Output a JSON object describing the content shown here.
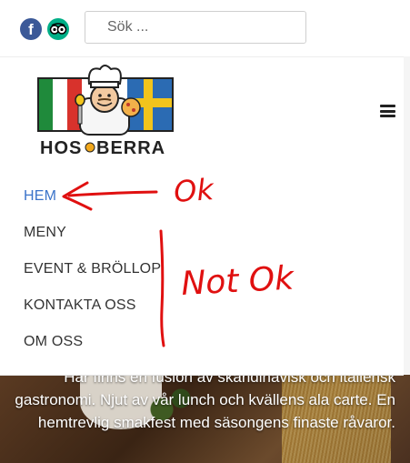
{
  "topbar": {
    "facebook_icon": "facebook-icon",
    "tripadvisor_icon": "tripadvisor-icon",
    "search_placeholder": "Sök ..."
  },
  "logo": {
    "text_left": "HOS",
    "text_right": "BERRA",
    "colors": {
      "italy_green": "#1f8a3b",
      "italy_red": "#d8322c",
      "sweden_blue": "#2b6bb3",
      "sweden_yellow": "#f2c41c"
    }
  },
  "nav": {
    "toggle_icon": "hamburger-menu-icon",
    "items": [
      {
        "label": "HEM",
        "active": true
      },
      {
        "label": "MENY",
        "active": false
      },
      {
        "label": "EVENT & BRÖLLOP",
        "active": false
      },
      {
        "label": "KONTAKTA OSS",
        "active": false
      },
      {
        "label": "OM OSS",
        "active": false
      }
    ]
  },
  "hero": {
    "text": "Här finns en fusion av skandinavisk och italiensk gastronomi. Njut av vår lunch och kvällens ala carte. En hemtrevlig smakfest med säsongens finaste råvaror."
  },
  "annotations": {
    "ok_label": "Ok",
    "not_ok_label": "Not Ok",
    "color": "#e01010"
  }
}
